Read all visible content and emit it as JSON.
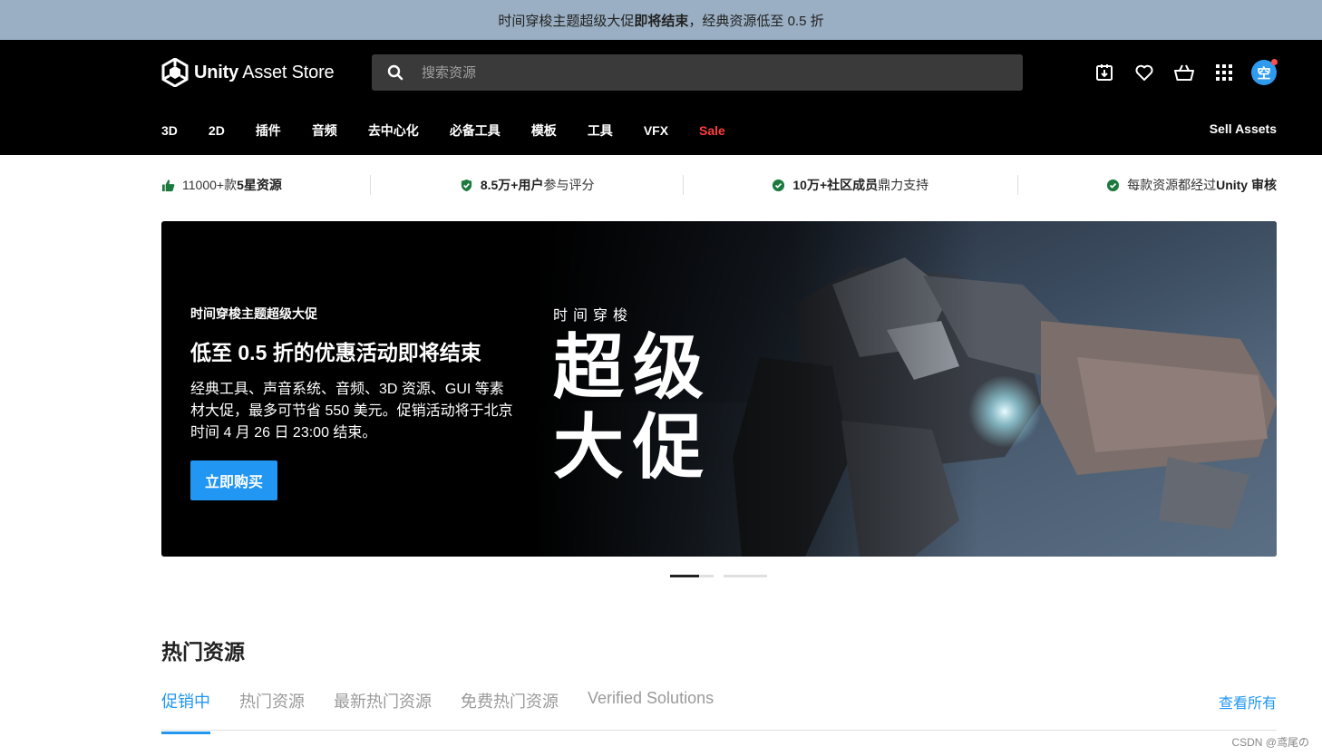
{
  "promo": {
    "text_prefix": "时间穿梭主题超级大促",
    "text_bold": "即将结束",
    "text_suffix": "，经典资源低至 0.5 折"
  },
  "header": {
    "logo_brand": "Unity",
    "logo_rest": " Asset Store",
    "search_placeholder": "搜索资源",
    "icons": [
      "download-icon",
      "heart-icon",
      "cart-icon",
      "apps-grid-icon"
    ],
    "avatar_initial": "空"
  },
  "nav": {
    "items": [
      "3D",
      "2D",
      "插件",
      "音频",
      "去中心化",
      "必备工具",
      "模板",
      "工具",
      "VFX",
      "Sale"
    ],
    "sell_label": "Sell Assets"
  },
  "trust": [
    {
      "pre": "11000+款",
      "bold": "5星资源",
      "post": ""
    },
    {
      "pre": "",
      "bold": "8.5万+用户",
      "post": "参与评分"
    },
    {
      "pre": "",
      "bold": "10万+社区成员",
      "post": "鼎力支持"
    },
    {
      "pre": "每款资源都经过 ",
      "bold": "Unity 审核",
      "post": ""
    }
  ],
  "hero": {
    "eyebrow": "时间穿梭主题超级大促",
    "title": "低至 0.5 折的优惠活动即将结束",
    "desc": "经典工具、声音系统、音频、3D 资源、GUI 等素材大促，最多可节省 550 美元。促销活动将于北京时间 4 月 26 日 23:00 结束。",
    "cta": "立即购买",
    "overlay_sub": "时间穿梭",
    "overlay_big_1": "超级",
    "overlay_big_2": "大促"
  },
  "carousel": {
    "slides": 2,
    "active": 1
  },
  "popular": {
    "title": "热门资源",
    "tabs": [
      "促销中",
      "热门资源",
      "最新热门资源",
      "免费热门资源",
      "Verified Solutions"
    ],
    "active_tab": 0,
    "view_all": "查看所有"
  },
  "watermark": "CSDN @鸢尾の",
  "colors": {
    "accent": "#2196f3",
    "sale": "#ff3d3d",
    "promo_bg": "#9aafc3",
    "check": "#1b7a3e"
  }
}
